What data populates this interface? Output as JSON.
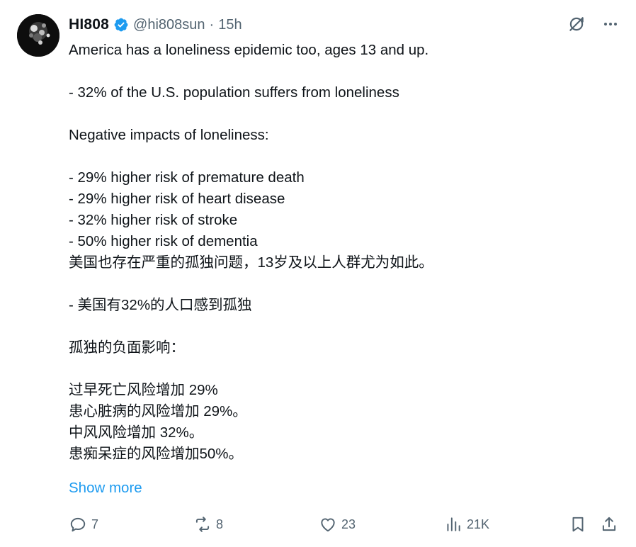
{
  "author": {
    "display_name": "HI808",
    "handle": "@hi808sun",
    "separator": "·",
    "time": "15h"
  },
  "icons": {
    "verified": "verified-badge-icon",
    "grok": "grok-icon",
    "more": "more-icon",
    "reply": "reply-icon",
    "repost": "repost-icon",
    "like": "like-icon",
    "views": "views-icon",
    "bookmark": "bookmark-icon",
    "share": "share-icon"
  },
  "colors": {
    "link": "#1d9bf0",
    "verified": "#1d9bf0",
    "muted": "#536471"
  },
  "tweet": {
    "lines": [
      "America has a loneliness epidemic too, ages 13 and up.",
      "",
      "- 32% of the U.S. population suffers from loneliness",
      "",
      "Negative impacts of loneliness:",
      "",
      "- 29% higher risk of premature death",
      "- 29% higher risk of heart disease",
      "- 32% higher risk of stroke",
      "- 50% higher risk of dementia",
      "美国也存在严重的孤独问题，13岁及以上人群尤为如此。",
      "",
      "- 美国有32%的人口感到孤独",
      "",
      "孤独的负面影响：",
      "",
      "过早死亡风险增加 29%",
      "患心脏病的风险增加 29%。",
      "中风风险增加 32%。",
      "患痴呆症的风险增加50%。"
    ],
    "show_more": "Show more"
  },
  "stats": {
    "replies": "7",
    "reposts": "8",
    "likes": "23",
    "views": "21K"
  }
}
